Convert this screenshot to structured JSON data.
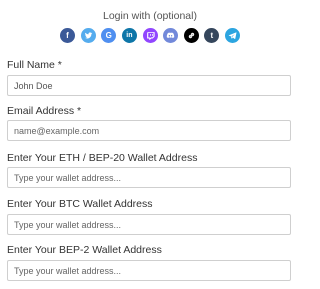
{
  "login": {
    "title": "Login with (optional)",
    "providers": [
      {
        "name": "facebook",
        "color": "#3b5998",
        "glyph": "f"
      },
      {
        "name": "twitter",
        "color": "#55acee",
        "glyph": "twitter-bird"
      },
      {
        "name": "google",
        "color": "#4f8ff0",
        "glyph": "G"
      },
      {
        "name": "linkedin",
        "color": "#0e76a8",
        "glyph": "in"
      },
      {
        "name": "twitch",
        "color": "#9146ff",
        "glyph": "twitch"
      },
      {
        "name": "discord",
        "color": "#7289da",
        "glyph": "discord"
      },
      {
        "name": "chain-link",
        "color": "#000000",
        "glyph": "link"
      },
      {
        "name": "tumblr",
        "color": "#35465c",
        "glyph": "t"
      },
      {
        "name": "telegram",
        "color": "#2ca5e0",
        "glyph": "plane"
      }
    ]
  },
  "form": {
    "full_name": {
      "label": "Full Name *",
      "value": "John Doe"
    },
    "email": {
      "label": "Email Address *",
      "placeholder": "name@example.com"
    },
    "eth_wallet": {
      "label": "Enter Your ETH / BEP-20 Wallet Address",
      "placeholder": "Type your wallet address..."
    },
    "btc_wallet": {
      "label": "Enter Your BTC Wallet Address",
      "placeholder": "Type your wallet address..."
    },
    "bep2_wallet": {
      "label": "Enter Your BEP-2 Wallet Address",
      "placeholder": "Type your wallet address..."
    }
  }
}
